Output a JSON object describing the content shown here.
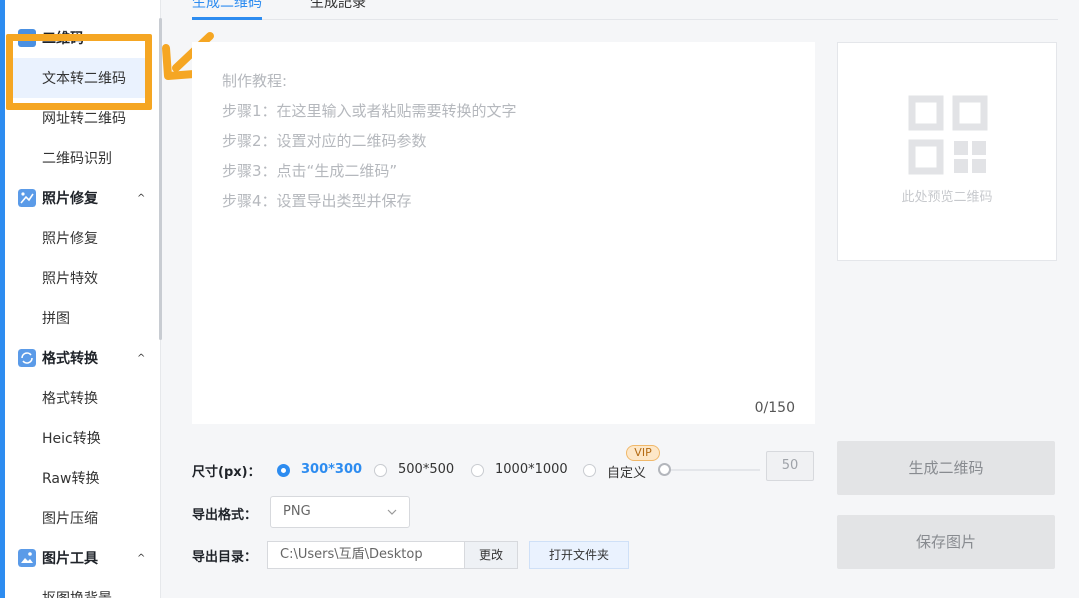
{
  "tabs": [
    {
      "label": "生成二维码"
    },
    {
      "label": "生成記录"
    }
  ],
  "sidebar": {
    "groups": [
      {
        "label": "二维码",
        "icon": "qr-group-icon"
      },
      {
        "label": "照片修复",
        "icon": "photo-repair-icon",
        "chevron": "^"
      },
      {
        "label": "格式转换",
        "icon": "format-convert-icon",
        "chevron": "^"
      },
      {
        "label": "图片工具",
        "icon": "image-tools-icon",
        "chevron": "^"
      }
    ],
    "items": [
      {
        "label": "文本转二维码"
      },
      {
        "label": "网址转二维码"
      },
      {
        "label": "二维码识别"
      },
      {
        "label": "照片修复"
      },
      {
        "label": "照片特效"
      },
      {
        "label": "拼图"
      },
      {
        "label": "格式转换"
      },
      {
        "label": "Heic转换"
      },
      {
        "label": "Raw转换"
      },
      {
        "label": "图片压缩"
      },
      {
        "label": "抠图换背景"
      }
    ]
  },
  "editor": {
    "lines": [
      "制作教程:",
      "步骤1：在这里输入或者粘贴需要转换的文字",
      "步骤2：设置对应的二维码参数",
      "步骤3：点击“生成二维码”",
      "步骤4：设置导出类型并保存"
    ],
    "counter": "0/150"
  },
  "preview": {
    "caption": "此处预览二维码"
  },
  "options": {
    "size_label": "尺寸(px)：",
    "sizes": [
      {
        "label": "300*300",
        "checked": true
      },
      {
        "label": "500*500",
        "checked": false
      },
      {
        "label": "1000*1000",
        "checked": false
      },
      {
        "label": "自定义",
        "checked": false
      }
    ],
    "vip": "VIP",
    "custom_value": "50",
    "format_label": "导出格式：",
    "format_value": "PNG",
    "dir_label": "导出目录：",
    "dir_value": "C:\\Users\\互盾\\Desktop",
    "change_btn": "更改",
    "open_btn": "打开文件夹"
  },
  "actions": {
    "generate": "生成二维码",
    "save": "保存图片"
  },
  "colors": {
    "accent": "#2d8cf0",
    "highlight": "#f5a623"
  }
}
